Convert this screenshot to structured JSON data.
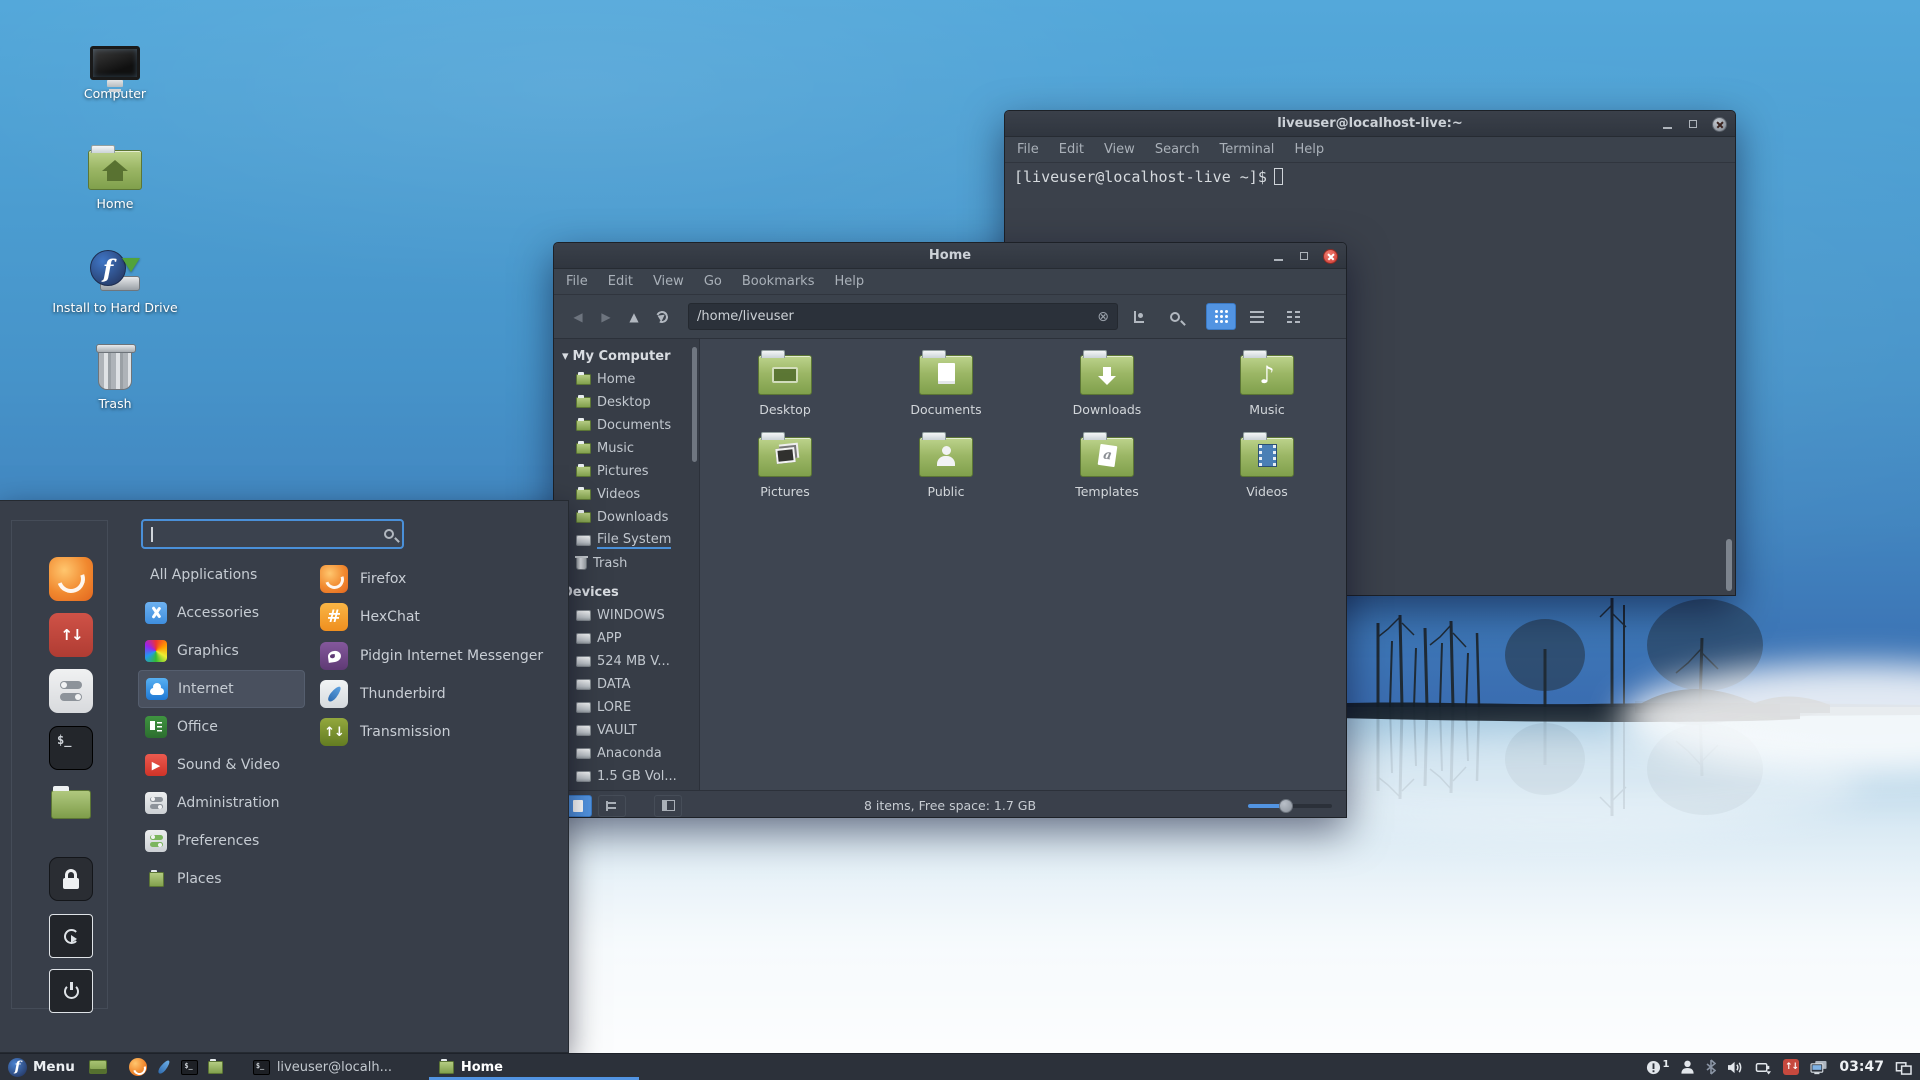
{
  "colors": {
    "accent": "#5294e2",
    "taskbar_bg": "#2c313a",
    "window_titlebar": "#353b45",
    "menu_bg": "#383e49",
    "sidebar_bg": "#373d47",
    "content_bg": "#3e4551",
    "folder_green": "#96b35f",
    "close_button_red": "#d84b42",
    "update_red": "#c6493e",
    "sky_blue": "#4693c9",
    "fog_white": "#eef5fa"
  },
  "glyphs": {
    "music_note": "♪",
    "template_letter": "a",
    "hexchat_hash": "#",
    "terminal_prompt": "$_",
    "fedora_f": "f",
    "updater_arrows": "↑↓",
    "transmission_arrows": "↑↓",
    "section_arrow": "▾",
    "play": "▶",
    "clear_entry": "⊗",
    "nav_back": "◀",
    "nav_forward": "▶",
    "nav_up": "▲"
  },
  "desktop": {
    "icons": [
      {
        "label": "Computer",
        "icon": "computer-icon"
      },
      {
        "label": "Home",
        "icon": "home-folder-icon"
      },
      {
        "label": "Install to Hard Drive",
        "icon": "install-to-hard-drive-icon"
      },
      {
        "label": "Trash",
        "icon": "trash-icon"
      }
    ]
  },
  "terminal": {
    "title": "liveuser@localhost-live:~",
    "menu": [
      "File",
      "Edit",
      "View",
      "Search",
      "Terminal",
      "Help"
    ],
    "prompt": "[liveuser@localhost-live ~]$"
  },
  "file_manager": {
    "title": "Home",
    "menu": [
      "File",
      "Edit",
      "View",
      "Go",
      "Bookmarks",
      "Help"
    ],
    "path": "/home/liveuser",
    "sidebar": {
      "computer": {
        "header": "My Computer",
        "items": [
          {
            "label": "Home",
            "icon": "folder-icon"
          },
          {
            "label": "Desktop",
            "icon": "folder-icon"
          },
          {
            "label": "Documents",
            "icon": "folder-icon"
          },
          {
            "label": "Music",
            "icon": "folder-icon"
          },
          {
            "label": "Pictures",
            "icon": "folder-icon"
          },
          {
            "label": "Videos",
            "icon": "folder-icon"
          },
          {
            "label": "Downloads",
            "icon": "folder-icon"
          },
          {
            "label": "File System",
            "icon": "drive-icon"
          },
          {
            "label": "Trash",
            "icon": "trash-icon"
          }
        ]
      },
      "devices": {
        "header": "Devices",
        "items": [
          {
            "label": "WINDOWS",
            "icon": "drive-icon"
          },
          {
            "label": "APP",
            "icon": "drive-icon"
          },
          {
            "label": "524 MB V...",
            "icon": "drive-icon"
          },
          {
            "label": "DATA",
            "icon": "drive-icon"
          },
          {
            "label": "LORE",
            "icon": "drive-icon"
          },
          {
            "label": "VAULT",
            "icon": "drive-icon"
          },
          {
            "label": "Anaconda",
            "icon": "drive-icon"
          },
          {
            "label": "1.5 GB Vol...",
            "icon": "drive-icon"
          }
        ]
      }
    },
    "folders": [
      {
        "label": "Desktop",
        "emblem": "desktop-screen"
      },
      {
        "label": "Documents",
        "emblem": "document-page"
      },
      {
        "label": "Downloads",
        "emblem": "down-arrow"
      },
      {
        "label": "Music",
        "emblem": "music-note"
      },
      {
        "label": "Pictures",
        "emblem": "photos"
      },
      {
        "label": "Public",
        "emblem": "person"
      },
      {
        "label": "Templates",
        "emblem": "template-page"
      },
      {
        "label": "Videos",
        "emblem": "film-strip"
      }
    ],
    "status": {
      "text": "8 items, Free space: 1.7 GB",
      "zoom_percent": 45
    }
  },
  "start_menu": {
    "search": {
      "value": "",
      "placeholder": ""
    },
    "favorites": [
      "firefox",
      "software-updater",
      "system-settings",
      "terminal",
      "file-manager",
      "lock-screen",
      "log-out",
      "power-off"
    ],
    "categories": [
      {
        "label": "All Applications"
      },
      {
        "label": "Accessories"
      },
      {
        "label": "Graphics"
      },
      {
        "label": "Internet"
      },
      {
        "label": "Office"
      },
      {
        "label": "Sound & Video"
      },
      {
        "label": "Administration"
      },
      {
        "label": "Preferences"
      },
      {
        "label": "Places"
      }
    ],
    "selected_category": "Internet",
    "apps": [
      {
        "label": "Firefox"
      },
      {
        "label": "HexChat"
      },
      {
        "label": "Pidgin Internet Messenger"
      },
      {
        "label": "Thunderbird"
      },
      {
        "label": "Transmission"
      }
    ]
  },
  "taskbar": {
    "menu_label": "Menu",
    "windows": [
      {
        "label": "liveuser@localh...",
        "active": false
      },
      {
        "label": "Home",
        "active": true
      }
    ],
    "tray": {
      "notification_count": "1",
      "clock": "03:47"
    }
  }
}
